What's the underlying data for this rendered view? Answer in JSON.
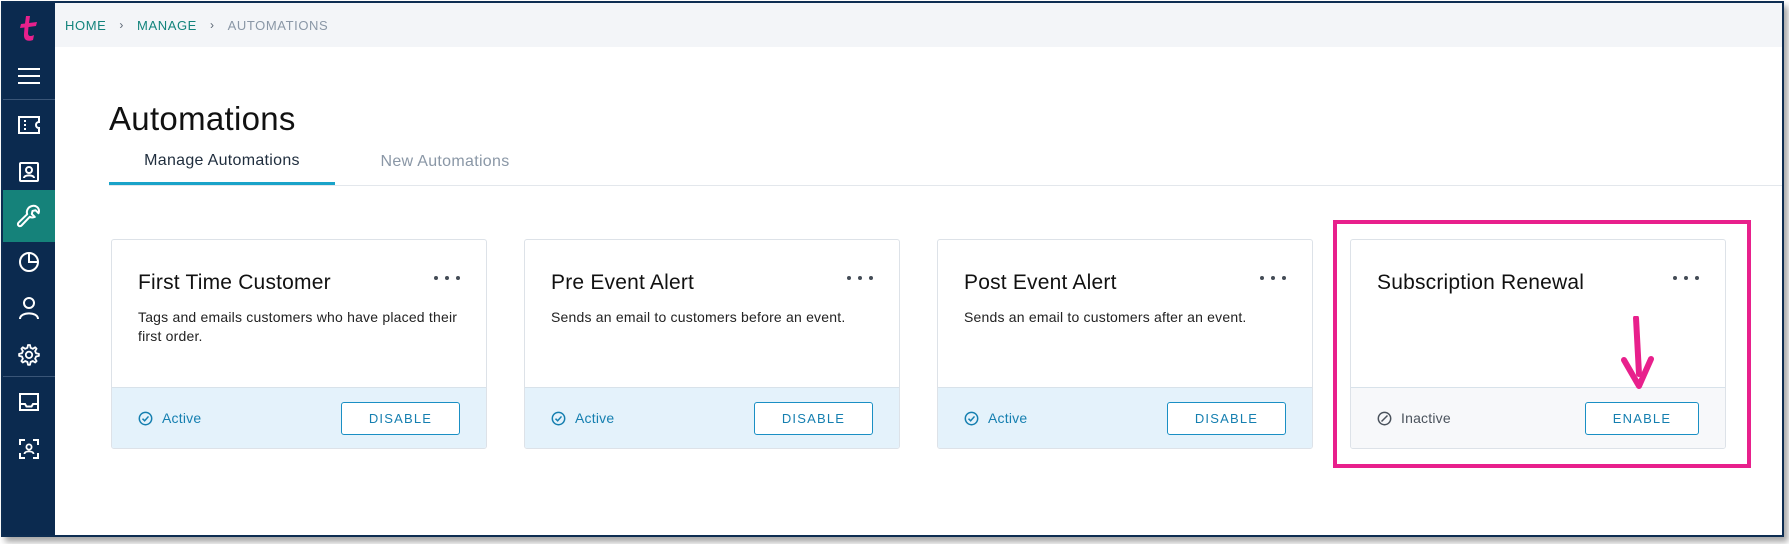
{
  "breadcrumb": {
    "home": "HOME",
    "manage": "MANAGE",
    "current": "AUTOMATIONS",
    "separator": "›"
  },
  "page": {
    "title": "Automations"
  },
  "tabs": [
    {
      "label": "Manage Automations",
      "active": true
    },
    {
      "label": "New Automations",
      "active": false
    }
  ],
  "sidebar": {
    "items": [
      {
        "icon": "logo-icon"
      },
      {
        "icon": "menu-icon"
      },
      {
        "icon": "ticket-icon"
      },
      {
        "icon": "contact-card-icon"
      },
      {
        "icon": "wrench-icon",
        "active": true
      },
      {
        "icon": "pie-chart-icon"
      },
      {
        "icon": "user-icon"
      },
      {
        "icon": "gear-icon"
      },
      {
        "icon": "inbox-icon"
      },
      {
        "icon": "scan-user-icon"
      }
    ]
  },
  "cards": [
    {
      "title": "First Time Customer",
      "description": "Tags and emails customers who have placed their first order.",
      "status": "Active",
      "button": "DISABLE"
    },
    {
      "title": "Pre Event Alert",
      "description": "Sends an email to customers before an event.",
      "status": "Active",
      "button": "DISABLE"
    },
    {
      "title": "Post Event Alert",
      "description": "Sends an email to customers after an event.",
      "status": "Active",
      "button": "DISABLE"
    },
    {
      "title": "Subscription Renewal",
      "description": "",
      "status": "Inactive",
      "button": "ENABLE"
    }
  ],
  "colors": {
    "sidebar": "#0b2a4f",
    "sidebar_active": "#15827a",
    "accent": "#157fb0",
    "highlight": "#e8208c",
    "brand": "#e8208c"
  }
}
